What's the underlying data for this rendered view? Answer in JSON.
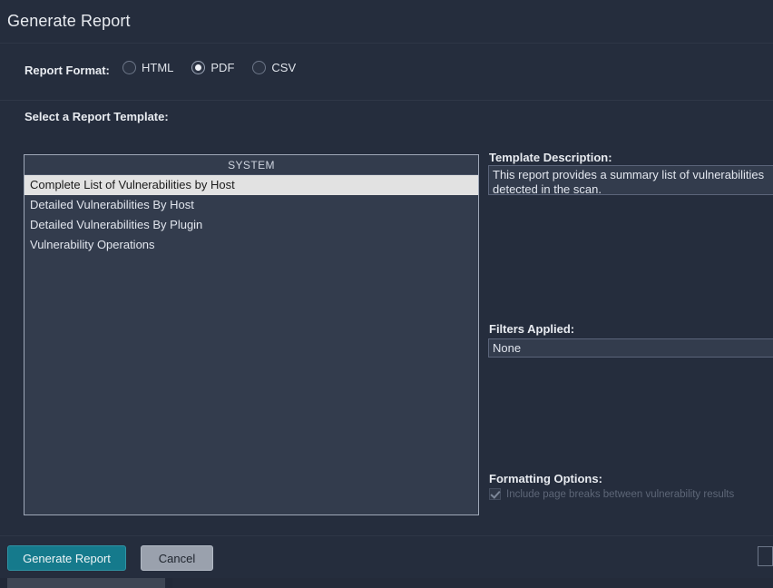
{
  "dialog": {
    "title": "Generate Report"
  },
  "format": {
    "label": "Report Format:",
    "options": [
      {
        "label": "HTML",
        "selected": false
      },
      {
        "label": "PDF",
        "selected": true
      },
      {
        "label": "CSV",
        "selected": false
      }
    ],
    "selected_value": "PDF"
  },
  "template_section": {
    "label": "Select a Report Template:",
    "list_header": "SYSTEM",
    "items": [
      {
        "label": "Complete List of Vulnerabilities by Host",
        "selected": true
      },
      {
        "label": "Detailed Vulnerabilities By Host",
        "selected": false
      },
      {
        "label": "Detailed Vulnerabilities By Plugin",
        "selected": false
      },
      {
        "label": "Vulnerability Operations",
        "selected": false
      }
    ],
    "selected_item": "Complete List of Vulnerabilities by Host"
  },
  "description": {
    "label": "Template Description:",
    "text": "This report provides a summary list of vulnerabilities\ndetected in the scan."
  },
  "filters": {
    "label": "Filters Applied:",
    "value": "None"
  },
  "formatting": {
    "label": "Formatting Options:",
    "option_label": "Include page breaks between vulnerability results",
    "option_checked": true
  },
  "footer": {
    "generate_label": "Generate Report",
    "cancel_label": "Cancel"
  },
  "colors": {
    "dialog_background": "#252d3d",
    "field_background": "#333c4d",
    "accent_primary": "#157a8c",
    "selection_background": "#e2e2e2",
    "text_primary": "#e8ebf0"
  }
}
